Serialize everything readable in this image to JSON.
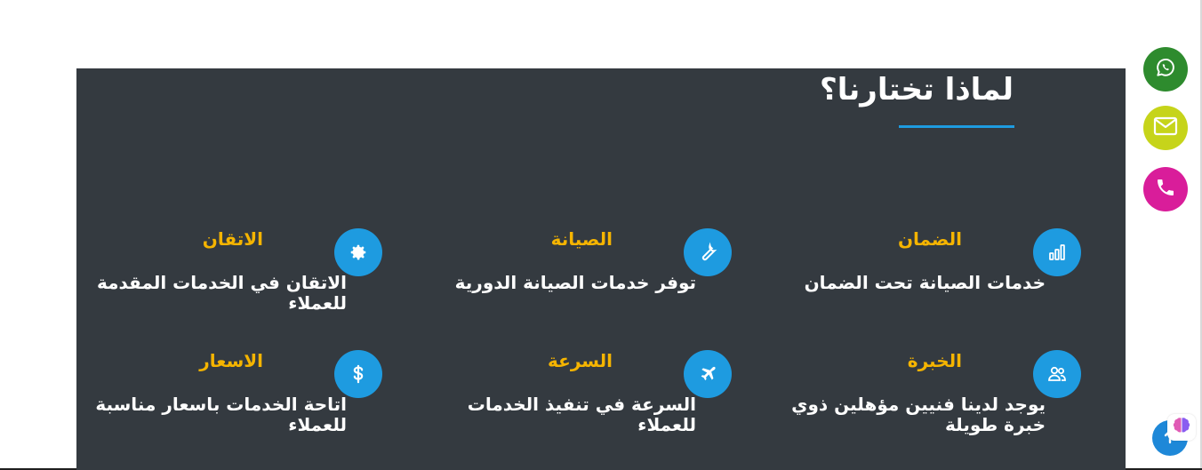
{
  "section": {
    "title": "لماذا تختارنا؟",
    "accent_color": "#1e9be0",
    "highlight_color": "#f5b400"
  },
  "features": [
    {
      "icon": "chart-icon",
      "title": "الضمان",
      "description": "خدمات الصيانة تحت الضمان"
    },
    {
      "icon": "wrench-icon",
      "title": "الصيانة",
      "description": "توفر خدمات الصيانة الدورية"
    },
    {
      "icon": "gear-icon",
      "title": "الاتقان",
      "description": "الاتقان في الخدمات المقدمة للعملاء"
    },
    {
      "icon": "users-icon",
      "title": "الخبرة",
      "description": "يوجد لدينا فنيين مؤهلين ذوي خبرة طويلة"
    },
    {
      "icon": "plane-icon",
      "title": "السرعة",
      "description": "السرعة في تنفيذ الخدمات للعملاء"
    },
    {
      "icon": "dollar-icon",
      "title": "الاسعار",
      "description": "اتاحة الخدمات باسعار مناسبة للعملاء"
    }
  ],
  "floating_contacts": [
    {
      "icon": "whatsapp-icon",
      "color": "#2e8b2e"
    },
    {
      "icon": "email-icon",
      "color": "#c6d41a"
    },
    {
      "icon": "phone-icon",
      "color": "#d91d9a"
    }
  ],
  "scroll_top": {
    "icon": "arrow-up-icon",
    "color": "#1e88d8"
  }
}
